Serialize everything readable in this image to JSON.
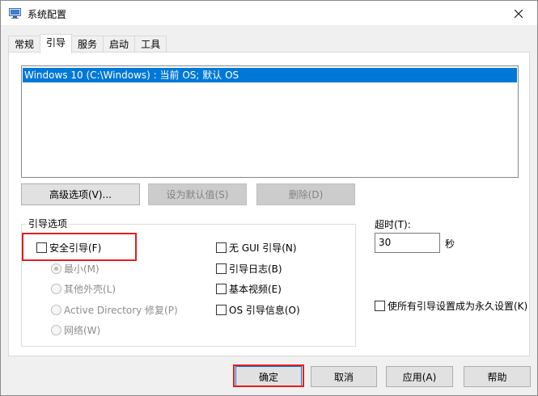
{
  "window": {
    "title": "系统配置",
    "close_label": "✕"
  },
  "tabs": [
    {
      "label": "常规"
    },
    {
      "label": "引导"
    },
    {
      "label": "服务"
    },
    {
      "label": "启动"
    },
    {
      "label": "工具"
    }
  ],
  "os_list": {
    "items": [
      "Windows 10 (C:\\Windows) : 当前 OS; 默认 OS"
    ]
  },
  "os_buttons": {
    "advanced": "高级选项(V)...",
    "set_default": "设为默认值(S)",
    "delete": "删除(D)"
  },
  "boot_options": {
    "label": "引导选项",
    "safe_boot": "安全引导(F)",
    "minimal": "最小(M)",
    "alternate_shell": "其他外壳(L)",
    "active_directory": "Active Directory 修复(P)",
    "network": "网络(W)",
    "no_gui_boot": "无 GUI 引导(N)",
    "boot_log": "引导日志(B)",
    "base_video": "基本视频(E)",
    "os_boot_info": "OS 引导信息(O)"
  },
  "timeout": {
    "label": "超时(T):",
    "value": "30",
    "unit": "秒"
  },
  "permanent": {
    "label": "使所有引导设置成为永久设置(K)"
  },
  "footer": {
    "ok": "确定",
    "cancel": "取消",
    "apply": "应用(A)",
    "help": "帮助"
  },
  "colors": {
    "selection": "#0078d7",
    "annotation_red": "#e0201e"
  }
}
